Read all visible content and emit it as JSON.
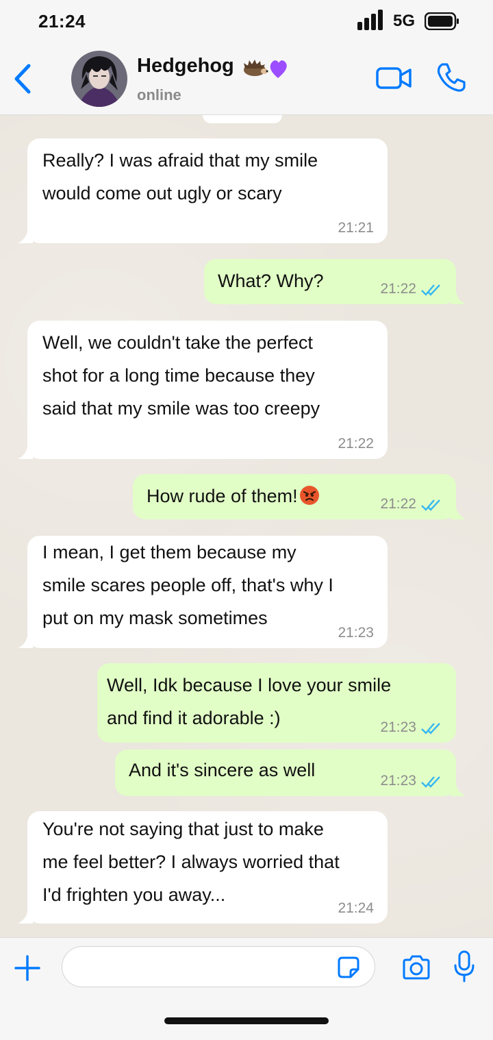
{
  "status_bar": {
    "time": "21:24",
    "network": "5G"
  },
  "header": {
    "contact_name": "Hedgehog",
    "name_emoji": [
      "hedgehog-emoji",
      "purple-heart-emoji"
    ],
    "status": "online",
    "colors": {
      "accent": "#007aff"
    }
  },
  "messages": [
    {
      "direction": "in",
      "text": "Really? I was afraid that my smile\nwould come out ugly or scary",
      "time": "21:21"
    },
    {
      "direction": "out",
      "text": "What? Why?",
      "time": "21:22",
      "read": true
    },
    {
      "direction": "in",
      "text": "Well, we couldn't take the perfect\nshot for a long time because they\nsaid that my smile was too creepy",
      "time": "21:22"
    },
    {
      "direction": "out",
      "text": "How rude of them!",
      "emoji": "angry-face-emoji",
      "time": "21:22",
      "read": true
    },
    {
      "direction": "in",
      "text": "I mean, I get them because my\nsmile scares people off, that's why I\nput on my mask sometimes",
      "time": "21:23"
    },
    {
      "direction": "out",
      "text": "Well, Idk because I love your smile\nand find it adorable :)",
      "time": "21:23",
      "read": true
    },
    {
      "direction": "out",
      "text": "And it's sincere as well",
      "time": "21:23",
      "read": true
    },
    {
      "direction": "in",
      "text": "You're not saying that just to make\nme feel better? I always worried that\nI'd frighten you away...",
      "time": "21:24"
    }
  ],
  "input_bar": {
    "placeholder": ""
  },
  "colors": {
    "incoming": "#ffffff",
    "outgoing": "#e1fec6",
    "read_ticks": "#34b7f1"
  }
}
